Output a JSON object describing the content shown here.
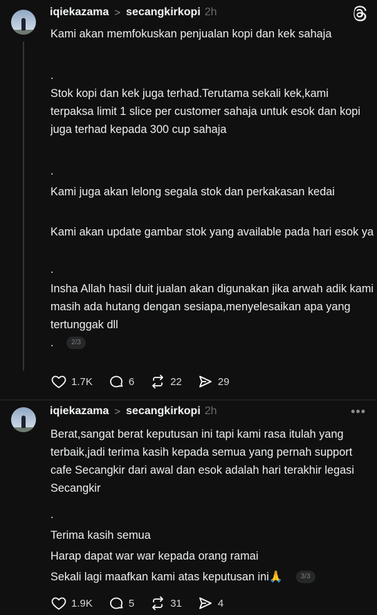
{
  "app": {
    "logo_icon": "threads-icon"
  },
  "posts": [
    {
      "username": "iqiekazama",
      "reply_to": "secangkirkopi",
      "time": "2h",
      "lines": [
        "Kami akan memfokuskan penjualan kopi dan kek sahaja",
        ".",
        "Stok kopi dan kek juga terhad.Terutama sekali kek,kami terpaksa limit 1 slice per customer sahaja untuk esok dan kopi juga terhad kepada 300 cup sahaja",
        ".",
        "Kami juga akan lelong segala stok dan perkakasan kedai",
        "Kami akan update gambar stok yang available pada hari esok ya",
        ".",
        "Insha Allah hasil duit jualan akan digunakan jika arwah adik kami masih ada hutang dengan sesiapa,menyelesaikan apa yang tertunggak dll"
      ],
      "last_line": ".",
      "page": "2/3",
      "likes": "1.7K",
      "comments": "6",
      "reposts": "22",
      "shares": "29"
    },
    {
      "username": "iqiekazama",
      "reply_to": "secangkirkopi",
      "time": "2h",
      "lines": [
        "Berat,sangat berat keputusan ini tapi kami rasa itulah yang terbaik,jadi terima kasih kepada semua yang pernah support cafe Secangkir dari awal dan esok adalah hari terakhir legasi Secangkir",
        ".",
        "Terima kasih semua",
        "Harap dapat war war kepada orang ramai"
      ],
      "last_line": "Sekali lagi maafkan kami atas keputusan ini🙏",
      "page": "3/3",
      "likes": "1.9K",
      "comments": "5",
      "reposts": "31",
      "shares": "4",
      "more_label": "•••"
    }
  ]
}
